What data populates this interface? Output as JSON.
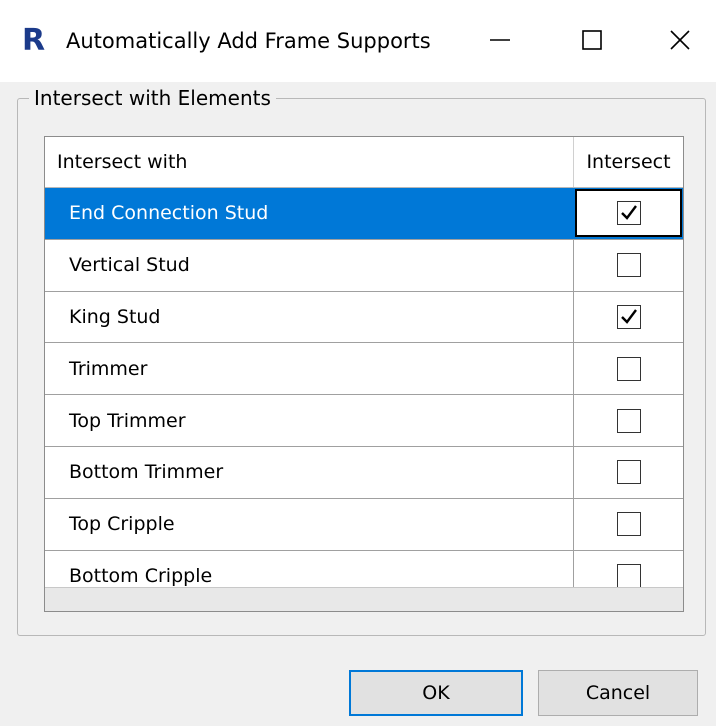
{
  "window": {
    "title": "Automatically Add Frame Supports",
    "app_icon_letter": "R",
    "minimize_icon": "minimize-icon",
    "maximize_icon": "maximize-icon",
    "close_icon": "close-icon"
  },
  "group": {
    "label": "Intersect with Elements"
  },
  "grid": {
    "columns": [
      "Intersect with",
      "Intersect"
    ],
    "rows": [
      {
        "name": "End Connection Stud",
        "checked": true,
        "selected": true
      },
      {
        "name": "Vertical Stud",
        "checked": false,
        "selected": false
      },
      {
        "name": "King Stud",
        "checked": true,
        "selected": false
      },
      {
        "name": "Trimmer",
        "checked": false,
        "selected": false
      },
      {
        "name": "Top Trimmer",
        "checked": false,
        "selected": false
      },
      {
        "name": "Bottom Trimmer",
        "checked": false,
        "selected": false
      },
      {
        "name": "Top Cripple",
        "checked": false,
        "selected": false
      },
      {
        "name": "Bottom Cripple",
        "checked": false,
        "selected": false
      }
    ]
  },
  "buttons": {
    "ok_label": "OK",
    "cancel_label": "Cancel"
  },
  "colors": {
    "selection": "#0078d7",
    "app_icon": "#1b3a8a"
  }
}
